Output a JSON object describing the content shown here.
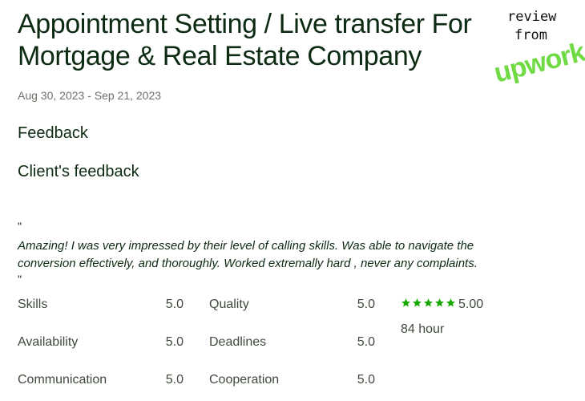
{
  "job": {
    "title_line1": "Appointment Setting / Live transfer For",
    "title_line2": "Mortgage & Real Estate Company",
    "dates": "Aug 30, 2023 - Sep 21, 2023"
  },
  "sections": {
    "feedback_heading": "Feedback",
    "client_feedback_heading": "Client's feedback"
  },
  "review": {
    "open_quote": "\"",
    "text": "Amazing! I was very impressed by their level of calling skills. Was able to navigate the conversion effectively, and thoroughly. Worked extremally hard , never any complaints.",
    "close_quote": "\""
  },
  "ratings": [
    {
      "label": "Skills",
      "value": "5.0"
    },
    {
      "label": "Quality",
      "value": "5.0"
    },
    {
      "label": "Availability",
      "value": "5.0"
    },
    {
      "label": "Deadlines",
      "value": "5.0"
    },
    {
      "label": "Communication",
      "value": "5.0"
    },
    {
      "label": "Cooperation",
      "value": "5.0"
    }
  ],
  "summary": {
    "stars": 5,
    "overall": "5.00",
    "hours": "84 hour"
  },
  "badge": {
    "line1": "review",
    "line2": "from",
    "logo_text": "upwork",
    "logo_color": "#6fda44"
  },
  "colors": {
    "star": "#14a800",
    "text_dark": "#0d2a12",
    "text_muted": "#6b7167"
  }
}
